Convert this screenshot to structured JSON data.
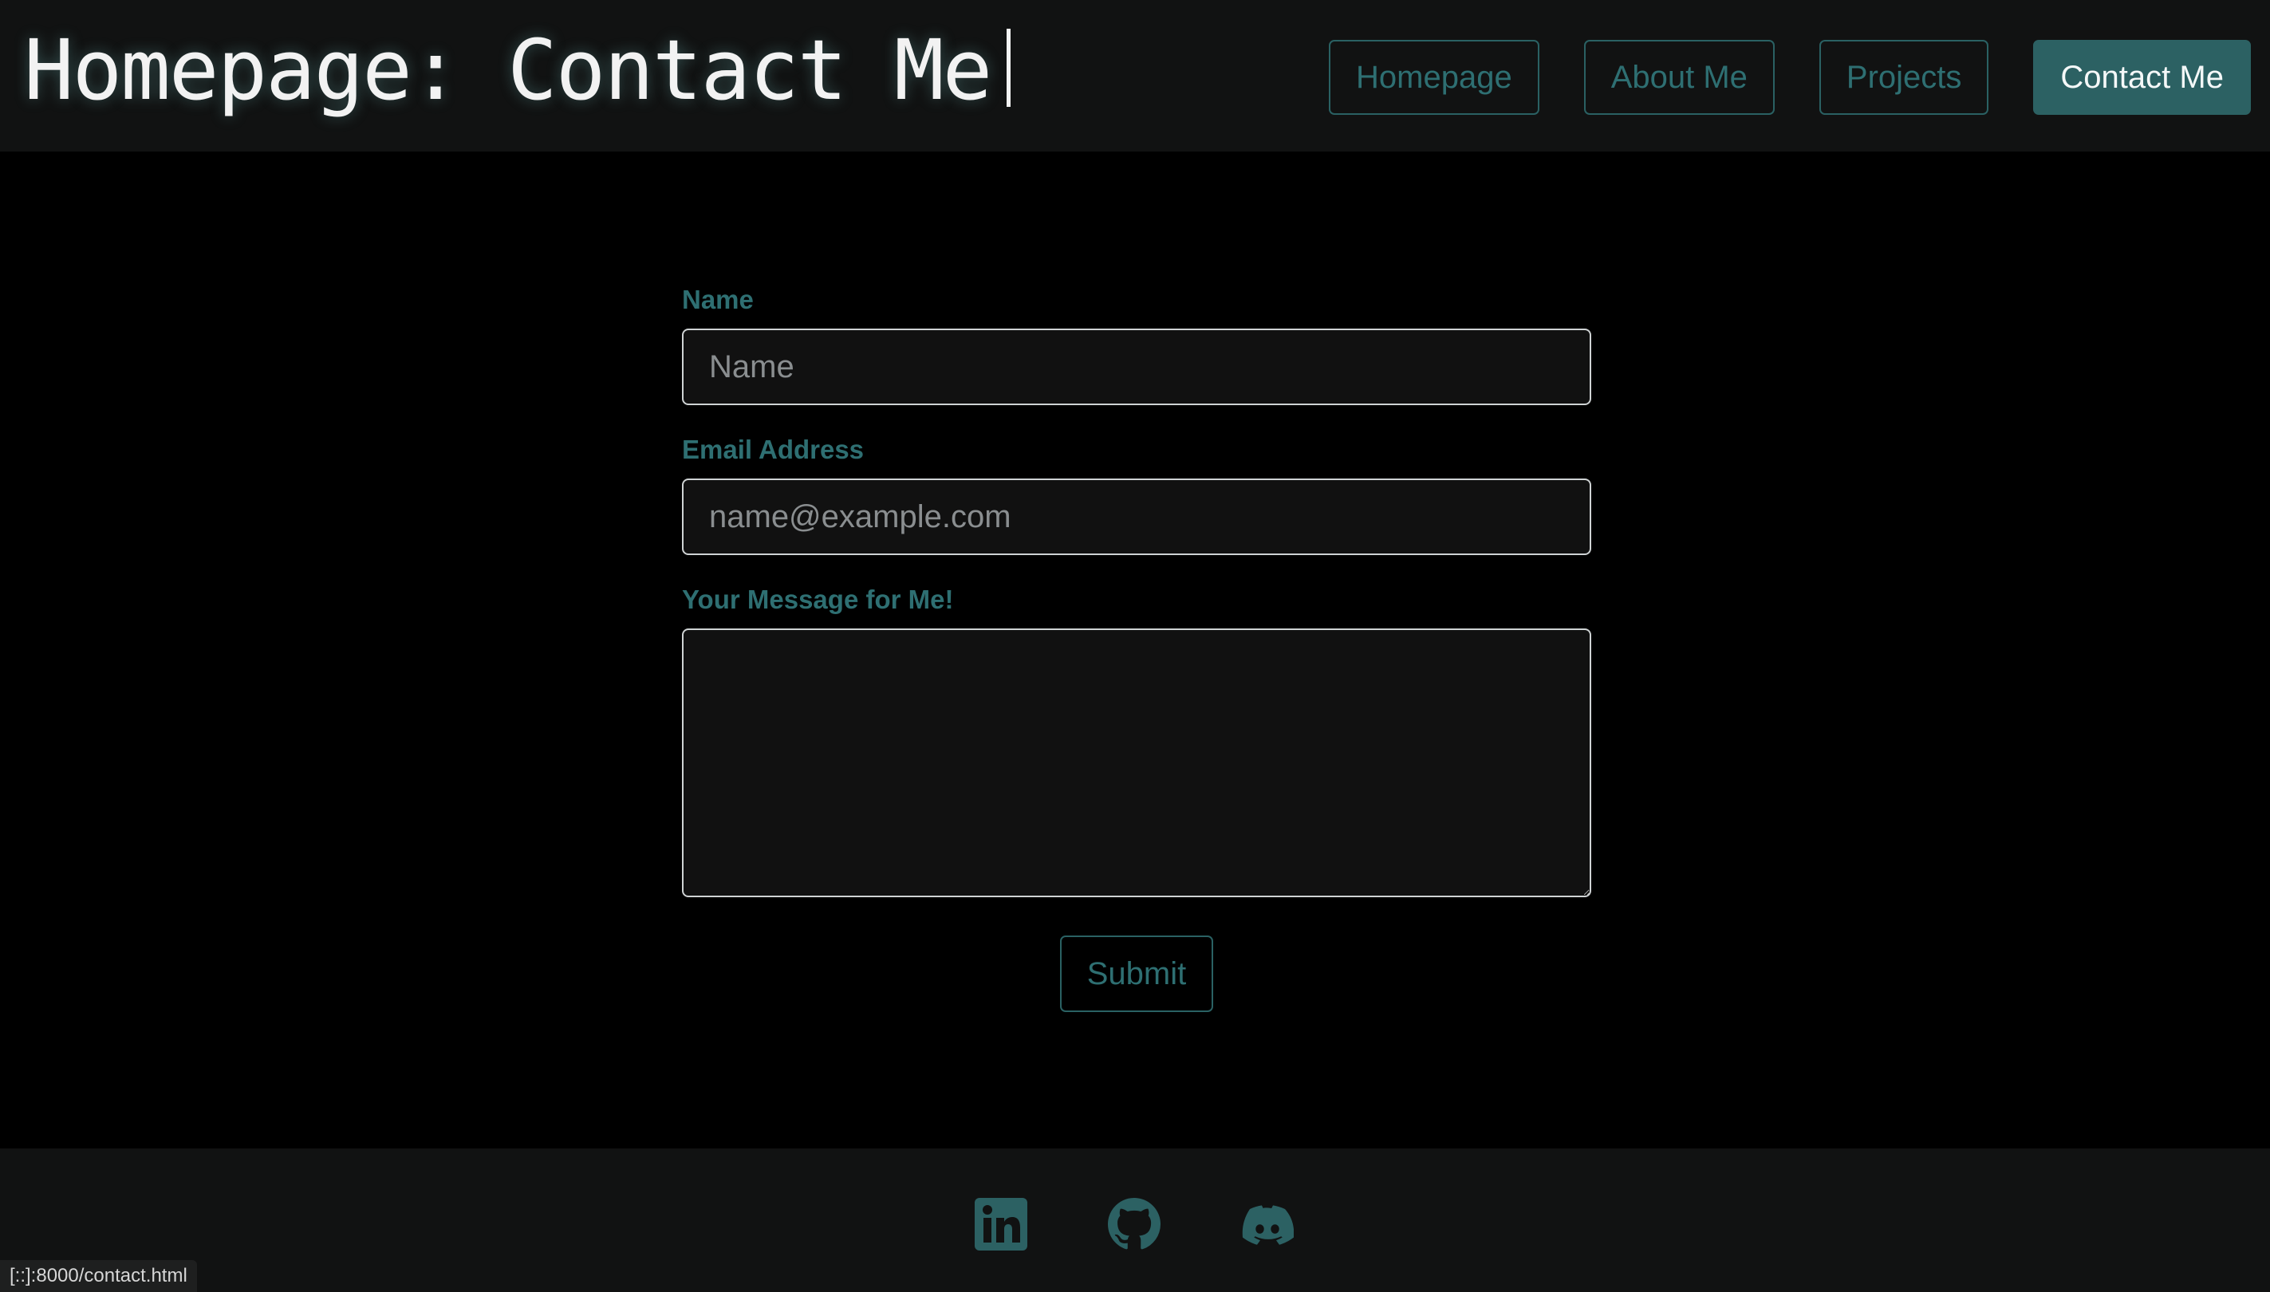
{
  "header": {
    "title": "Homepage: Contact Me",
    "nav": [
      {
        "label": "Homepage"
      },
      {
        "label": "About Me"
      },
      {
        "label": "Projects"
      },
      {
        "label": "Contact Me",
        "active": true
      }
    ]
  },
  "form": {
    "name_label": "Name",
    "name_placeholder": "Name",
    "email_label": "Email Address",
    "email_placeholder": "name@example.com",
    "message_label": "Your Message for Me!",
    "message_value": "",
    "submit_label": "Submit"
  },
  "footer": {
    "icons": [
      "linkedin-icon",
      "github-icon",
      "discord-icon"
    ]
  },
  "status_bar": {
    "url": "[::]:8000/contact.html"
  },
  "colors": {
    "accent": "#2c6163",
    "accent_text": "#2e6f72",
    "background": "#000000",
    "header_bg": "#111212",
    "input_bg": "#111111"
  }
}
